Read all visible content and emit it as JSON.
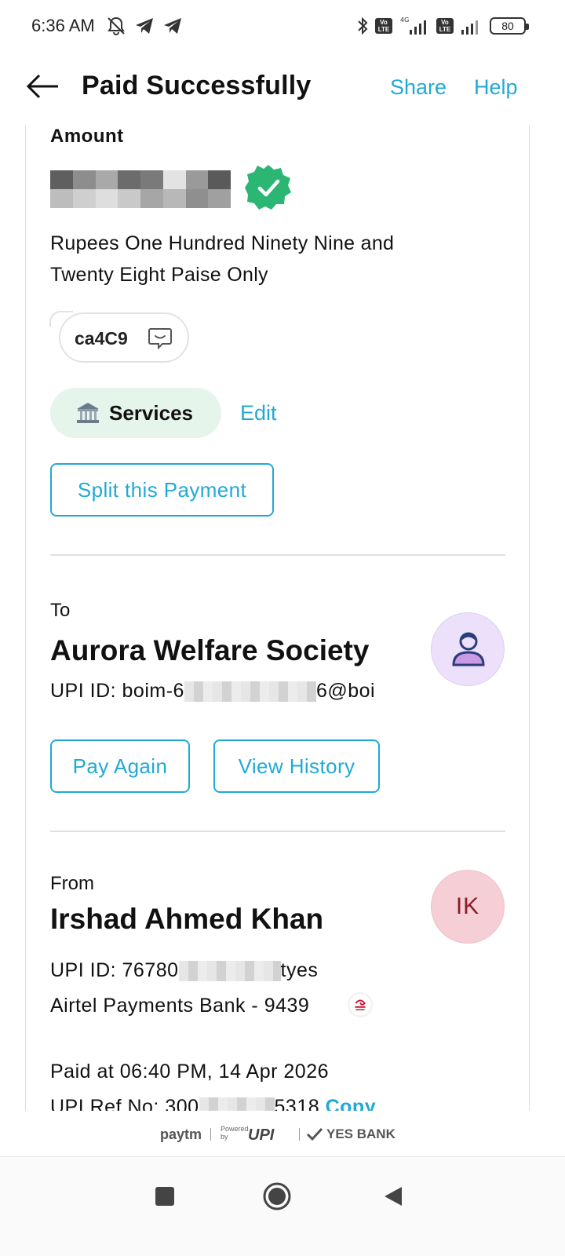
{
  "status_bar": {
    "time": "6:36 AM",
    "left_icons": [
      "notifications-off-icon",
      "telegram-icon",
      "telegram-icon"
    ],
    "right_icons": [
      "bluetooth-icon",
      "volte-icon",
      "signal-4g-icon",
      "volte-icon",
      "signal-icon"
    ],
    "network_label": "4G",
    "lte_label": "Vo LTE",
    "battery": "80"
  },
  "header": {
    "title": "Paid Successfully",
    "share_label": "Share",
    "help_label": "Help"
  },
  "amount": {
    "label": "Amount",
    "amount_in_words": "Rupees One Hundred Ninety Nine and Twenty Eight Paise Only",
    "verified_icon": "verified-badge-icon",
    "note": "ca4C9",
    "category": "Services",
    "edit_label": "Edit",
    "split_label": "Split this Payment"
  },
  "to": {
    "label": "To",
    "name": "Aurora Welfare Society",
    "upi_prefix": "UPI ID: boim-6",
    "upi_suffix": "6@boi",
    "pay_again_label": "Pay Again",
    "view_history_label": "View History"
  },
  "from": {
    "label": "From",
    "name": "Irshad Ahmed Khan",
    "initials": "IK",
    "upi_prefix": "UPI ID: 76780",
    "upi_suffix": "tyes",
    "bank": "Airtel Payments Bank - 9439",
    "paid_at": "Paid at 06:40 PM, 14 Apr 2026",
    "ref_prefix": "UPI Ref No: 300",
    "ref_suffix": "5318",
    "copy_label": "Copy"
  },
  "footer": {
    "paytm": "paytm",
    "powered_by": "Powered by",
    "upi": "UPI",
    "bank": "YES BANK"
  },
  "colors": {
    "accent": "#21a9d6",
    "success": "#2bb673",
    "category_bg": "#e6f5ec",
    "to_avatar_bg": "#ece0fa",
    "from_avatar_bg": "#f5cfd5"
  }
}
